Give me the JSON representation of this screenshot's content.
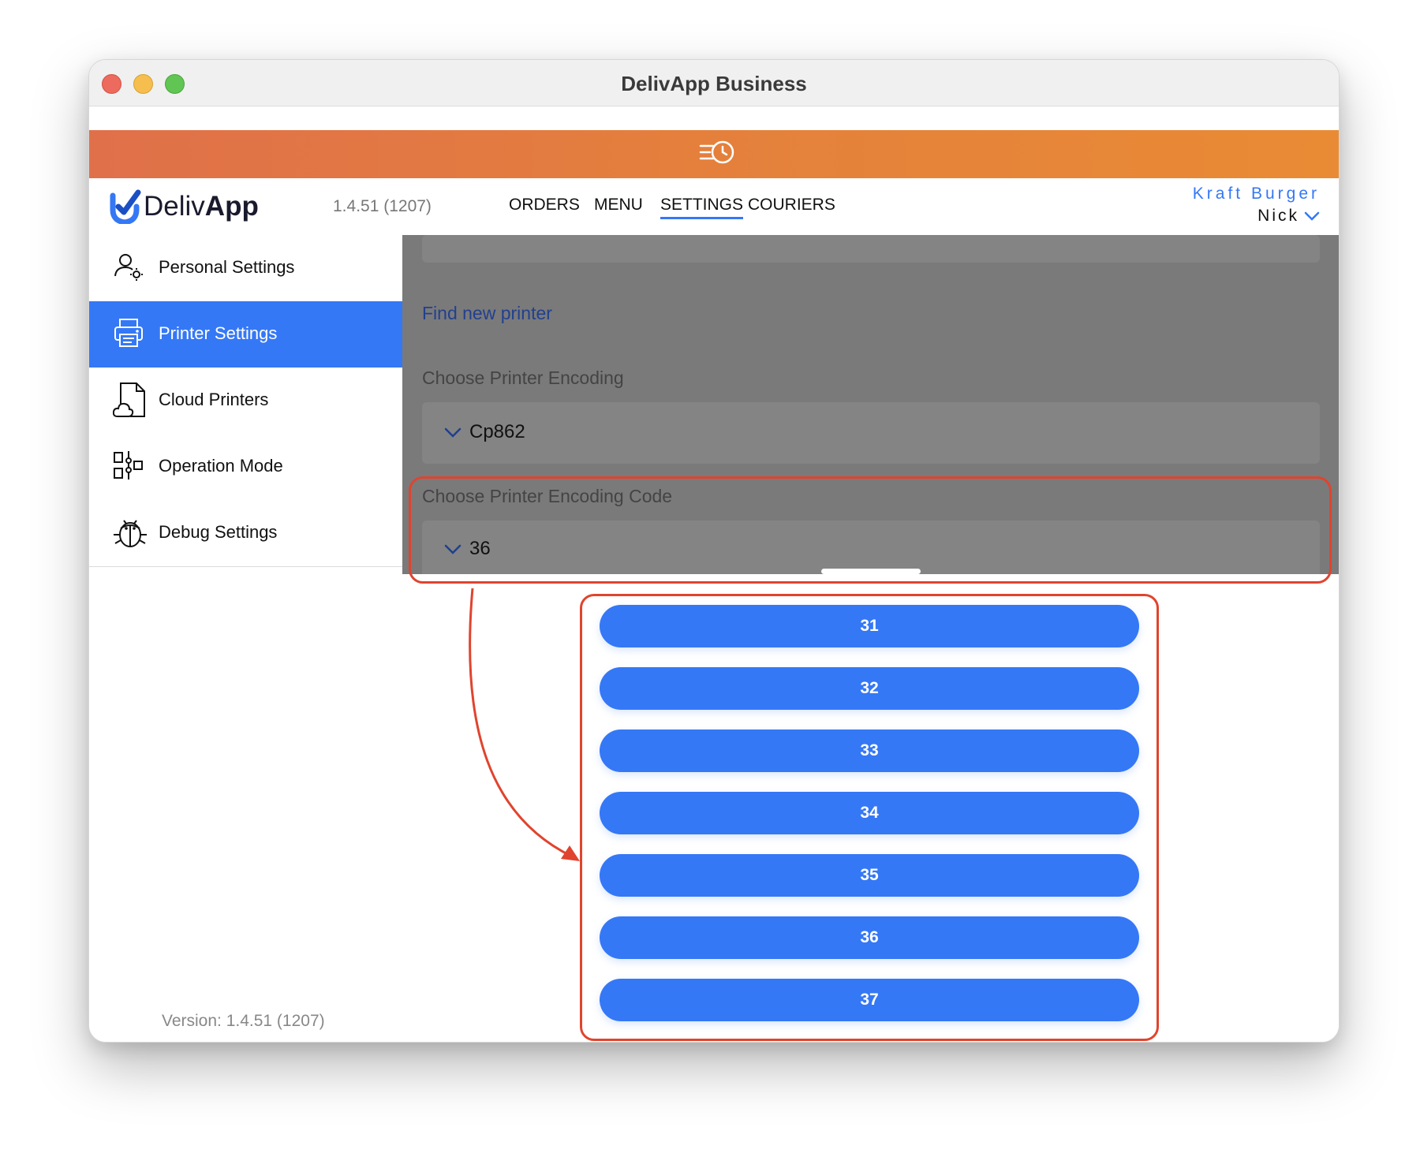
{
  "window": {
    "title": "DelivApp Business"
  },
  "header": {
    "brand_light": "Deliv",
    "brand_bold": "App",
    "version": "1.4.51 (1207)",
    "nav": [
      "ORDERS",
      "MENU",
      "SETTINGS",
      "COURIERS"
    ],
    "active_nav": "SETTINGS",
    "company": "Kraft Burger",
    "user": "Nick"
  },
  "sidebar": {
    "items": [
      {
        "label": "Personal Settings",
        "icon": "user-gear-icon"
      },
      {
        "label": "Printer Settings",
        "icon": "printer-icon",
        "active": true
      },
      {
        "label": "Cloud Printers",
        "icon": "cloud-document-icon"
      },
      {
        "label": "Operation Mode",
        "icon": "operation-mode-icon"
      },
      {
        "label": "Debug Settings",
        "icon": "bug-icon"
      }
    ],
    "version": "Version: 1.4.51 (1207)"
  },
  "main": {
    "find_printer_link": "Find new printer",
    "encoding_label": "Choose Printer Encoding",
    "encoding_value": "Cp862",
    "encoding_code_label": "Choose Printer Encoding Code",
    "encoding_code_value": "36"
  },
  "picker": {
    "options": [
      "31",
      "32",
      "33",
      "34",
      "35",
      "36",
      "37"
    ]
  },
  "colors": {
    "accent": "#3578f6",
    "topbar_start": "#e0704a",
    "topbar_end": "#e98b35",
    "annotation": "#e0442e"
  }
}
